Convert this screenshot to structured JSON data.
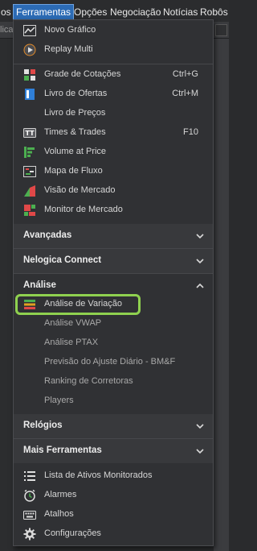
{
  "menubar": {
    "items": [
      "os",
      "Ferramentas",
      "Opções",
      "Negociação",
      "Notícias",
      "Robôs"
    ],
    "active": "Ferramentas"
  },
  "toolbar": {
    "left_fragment": "licac"
  },
  "menu": {
    "group1": [
      {
        "label": "Novo Gráfico",
        "icon": "line-chart-icon"
      },
      {
        "label": "Replay Multi",
        "icon": "replay-icon"
      }
    ],
    "group2": [
      {
        "label": "Grade de Cotações",
        "shortcut": "Ctrl+G",
        "icon": "quote-grid-icon"
      },
      {
        "label": "Livro de Ofertas",
        "shortcut": "Ctrl+M",
        "icon": "order-book-icon"
      },
      {
        "label": "Livro de Preços",
        "shortcut": "",
        "icon": ""
      },
      {
        "label": "Times & Trades",
        "shortcut": "F10",
        "icon": "times-trades-icon"
      },
      {
        "label": "Volume at Price",
        "shortcut": "",
        "icon": "volume-at-price-icon"
      },
      {
        "label": "Mapa de Fluxo",
        "shortcut": "",
        "icon": "flow-map-icon"
      },
      {
        "label": "Visão de Mercado",
        "shortcut": "",
        "icon": "market-view-icon"
      },
      {
        "label": "Monitor de Mercado",
        "shortcut": "",
        "icon": "market-monitor-icon"
      }
    ],
    "sections": {
      "avancadas": "Avançadas",
      "nelogica": "Nelogica Connect",
      "analise": "Análise",
      "relogios": "Relógios",
      "mais": "Mais Ferramentas"
    },
    "analise_items": [
      {
        "label": "Análise de Variação",
        "icon": "variation-analysis-icon",
        "highlighted": true
      },
      {
        "label": "Análise VWAP"
      },
      {
        "label": "Análise PTAX"
      },
      {
        "label": "Previsão do Ajuste Diário - BM&F"
      },
      {
        "label": "Ranking de Corretoras"
      },
      {
        "label": "Players"
      }
    ],
    "mais_items": [
      {
        "label": "Lista de Ativos Monitorados",
        "icon": "list-icon"
      },
      {
        "label": "Alarmes",
        "icon": "alarm-clock-icon"
      },
      {
        "label": "Atalhos",
        "icon": "keyboard-icon"
      },
      {
        "label": "Configurações",
        "icon": "gear-icon"
      }
    ]
  },
  "colors": {
    "accent": "#2c6bb5",
    "highlight": "#8fd14f",
    "menu_bg": "#303134",
    "section_bg": "#38393c"
  }
}
